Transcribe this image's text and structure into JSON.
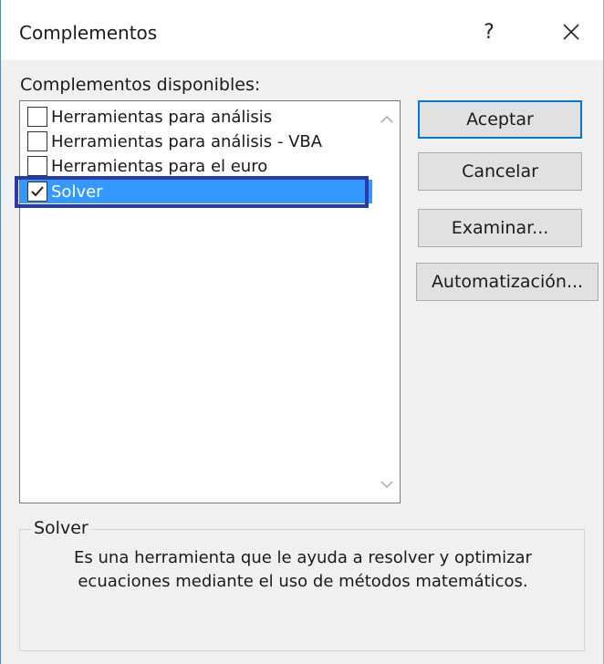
{
  "dialog": {
    "title": "Complementos",
    "help_glyph": "?",
    "available_label": "Complementos disponibles:"
  },
  "addins": [
    {
      "label": "Herramientas para análisis",
      "checked": false,
      "selected": false
    },
    {
      "label": "Herramientas para análisis - VBA",
      "checked": false,
      "selected": false
    },
    {
      "label": "Herramientas para el euro",
      "checked": false,
      "selected": false
    },
    {
      "label": "Solver",
      "checked": true,
      "selected": true
    }
  ],
  "buttons": {
    "accept": "Aceptar",
    "cancel": "Cancelar",
    "browse": "Examinar...",
    "automation": "Automatización..."
  },
  "details": {
    "heading": "Solver",
    "description_line1": "Es una herramienta que le ayuda a resolver y optimizar",
    "description_line2": "ecuaciones mediante el uso de métodos matemáticos."
  },
  "icons": {
    "help": "question-mark",
    "close": "close-x",
    "scroll_up": "chevron-up",
    "scroll_down": "chevron-down",
    "checkmark": "check"
  },
  "colors": {
    "selection": "#3399ff",
    "selection_outline": "#2a3aa8",
    "default_button_border": "#0078d7"
  }
}
